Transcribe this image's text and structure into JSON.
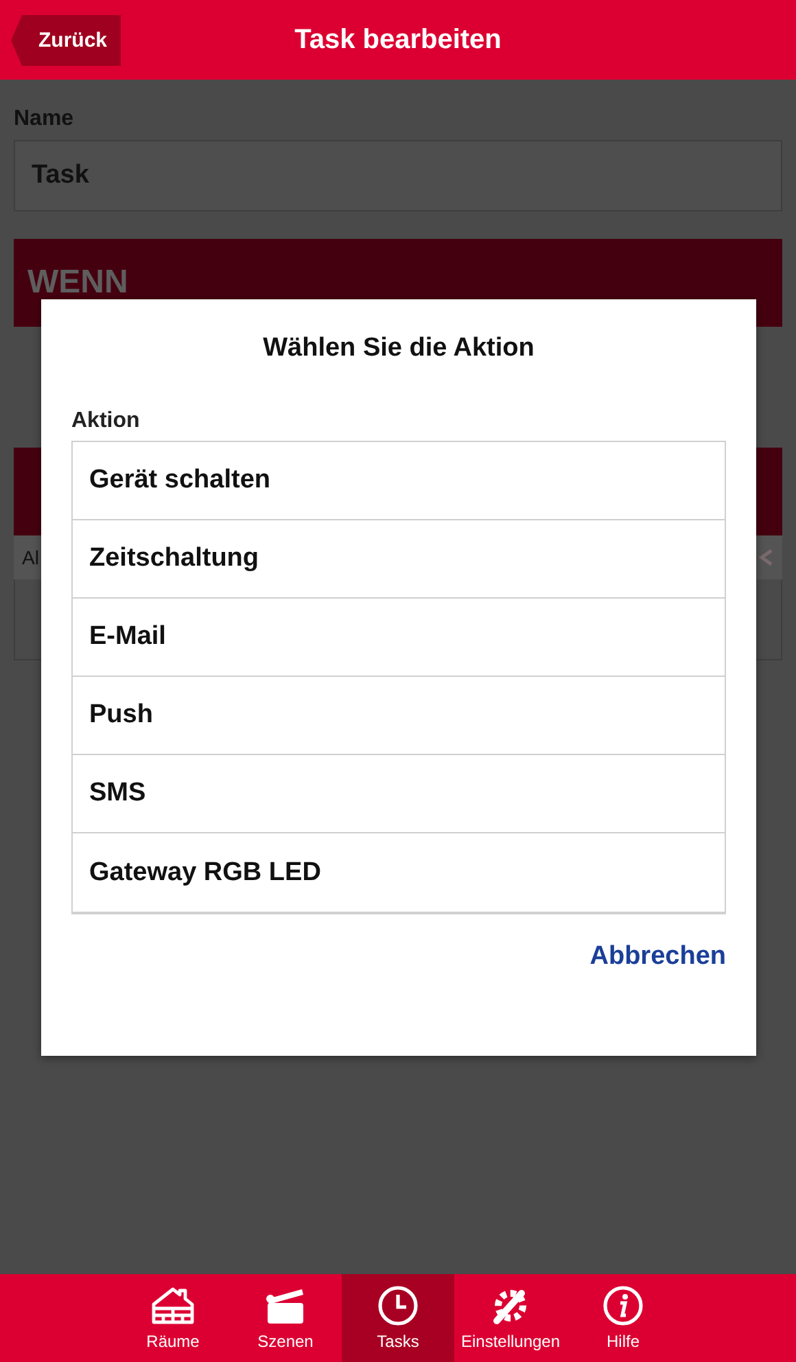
{
  "header": {
    "back": "Zurück",
    "title": "Task bearbeiten"
  },
  "form": {
    "name_label": "Name",
    "name_value": "Task",
    "if_section": "WENN",
    "then_row": "Al"
  },
  "dialog": {
    "title": "Wählen Sie die Aktion",
    "label": "Aktion",
    "options": [
      {
        "label": "Gerät schalten"
      },
      {
        "label": "Zeitschaltung"
      },
      {
        "label": "E-Mail"
      },
      {
        "label": "Push"
      },
      {
        "label": "SMS"
      },
      {
        "label": "Gateway RGB LED"
      }
    ],
    "cancel": "Abbrechen"
  },
  "nav": [
    {
      "label": "Räume",
      "kind": "house",
      "selected": false
    },
    {
      "label": "Szenen",
      "kind": "clapper",
      "selected": false
    },
    {
      "label": "Tasks",
      "kind": "clock",
      "selected": true
    },
    {
      "label": "Einstellungen",
      "kind": "tools",
      "selected": false
    },
    {
      "label": "Hilfe",
      "kind": "info",
      "selected": false
    }
  ]
}
